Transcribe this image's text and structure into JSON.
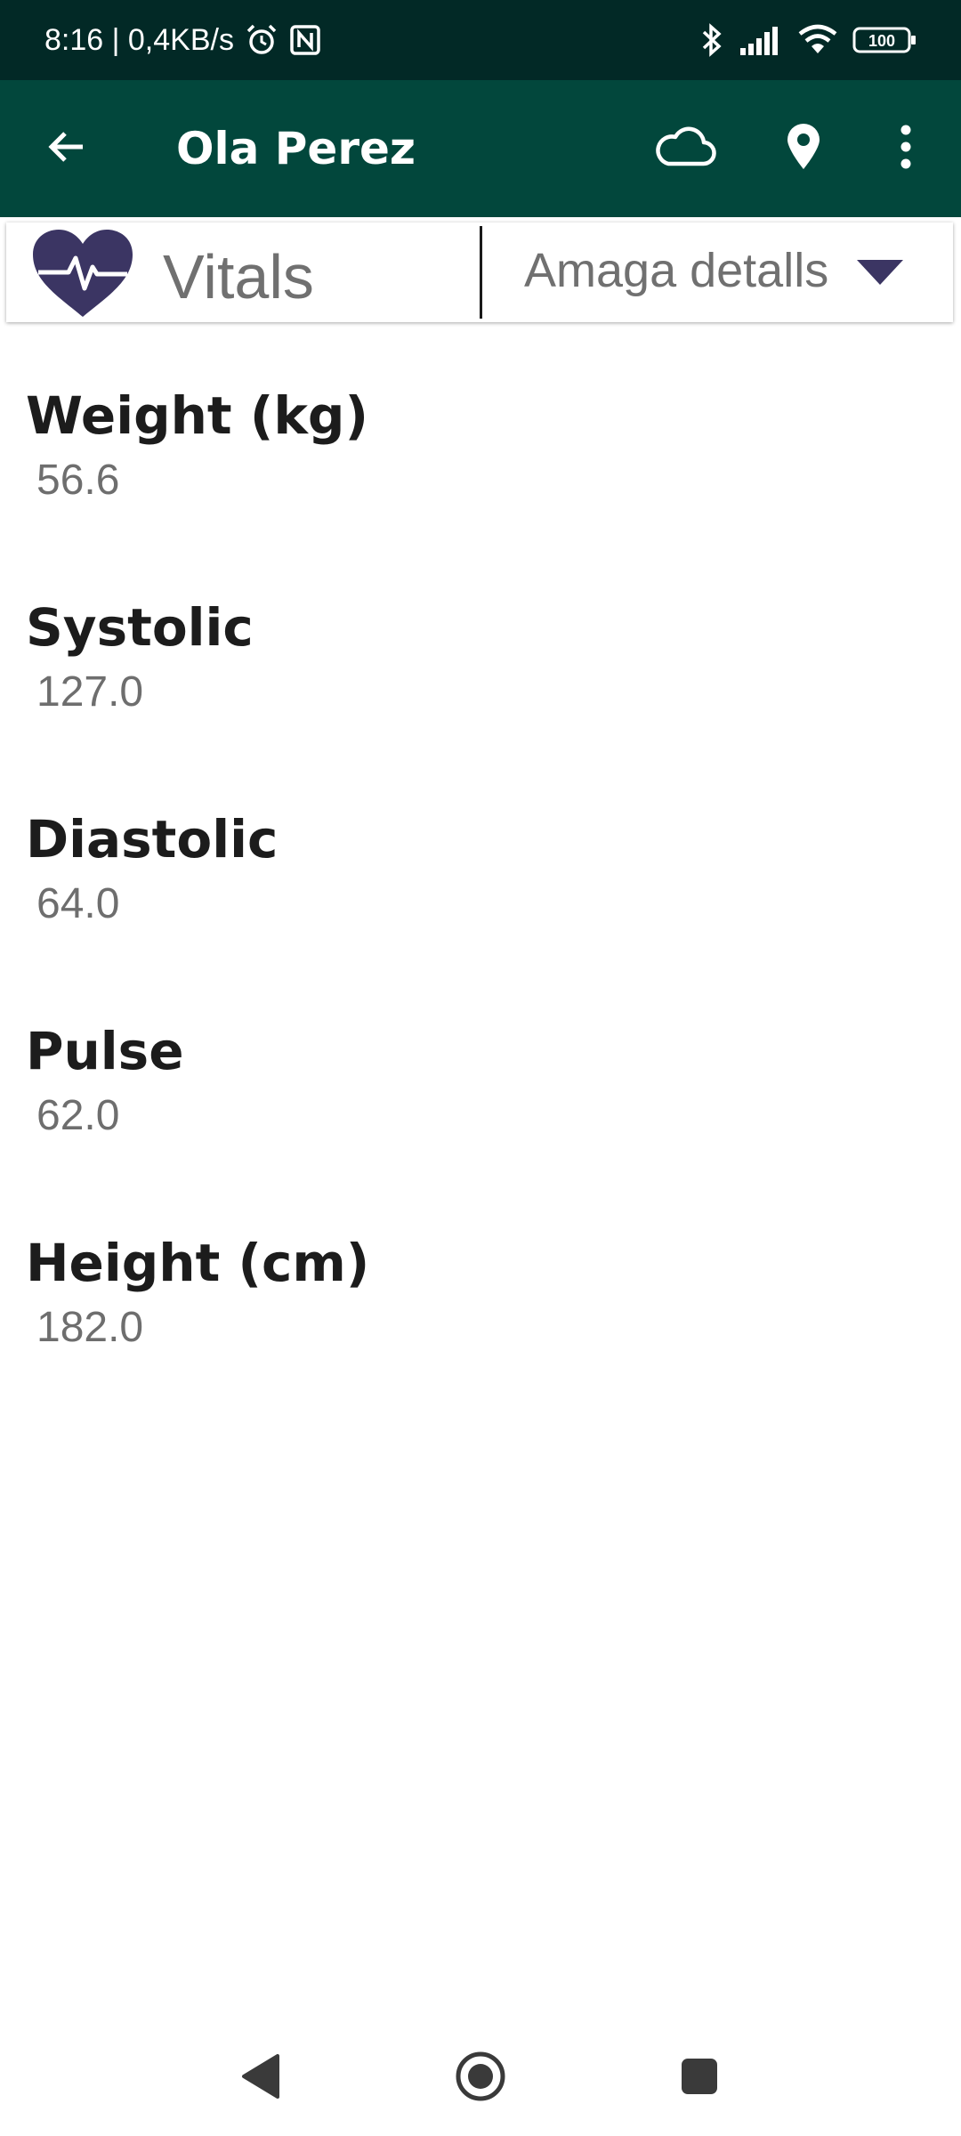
{
  "status_bar": {
    "time_speed": "8:16 | 0,4KB/s",
    "battery": "100",
    "icons": [
      "alarm-icon",
      "nfc-icon",
      "bluetooth-icon",
      "signal-icon",
      "wifi-icon",
      "battery-icon"
    ]
  },
  "app_bar": {
    "title": "Ola Perez",
    "icons": [
      "back-arrow-icon",
      "cloud-icon",
      "location-pin-icon",
      "more-vert-icon"
    ]
  },
  "section": {
    "title": "Vitals",
    "icon": "heart-pulse-icon",
    "dropdown_label": "Amaga detalls"
  },
  "vitals": [
    {
      "label": "Weight (kg)",
      "value": "56.6"
    },
    {
      "label": "Systolic",
      "value": "127.0"
    },
    {
      "label": "Diastolic",
      "value": "64.0"
    },
    {
      "label": "Pulse",
      "value": "62.0"
    },
    {
      "label": "Height (cm)",
      "value": "182.0"
    }
  ],
  "nav_bar": {
    "icons": [
      "nav-back-icon",
      "nav-home-icon",
      "nav-recents-icon"
    ]
  },
  "colors": {
    "status_bar_bg": "#022926",
    "app_bar_bg": "#02473c",
    "heart_icon": "#3b3563",
    "label_text": "#1c1c1c",
    "value_text": "#6e6e6e"
  }
}
